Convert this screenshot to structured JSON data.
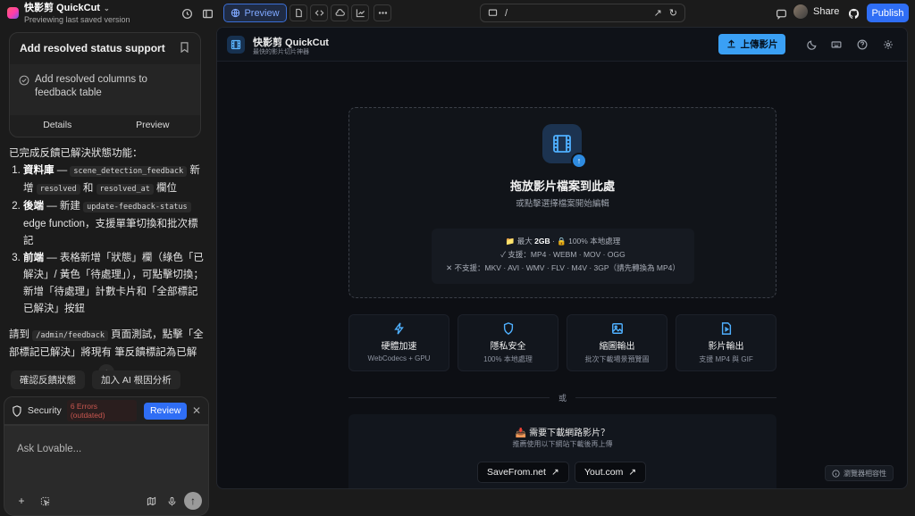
{
  "app": {
    "name": "快影剪 QuickCut",
    "subtitle": "Previewing last saved version"
  },
  "toolbar": {
    "preview_label": "Preview",
    "url_path": "/",
    "share_label": "Share",
    "publish_label": "Publish"
  },
  "card": {
    "title": "Add resolved status support",
    "item": "Add resolved columns to feedback table",
    "details_label": "Details",
    "preview_label": "Preview"
  },
  "message": {
    "intro": "已完成反饋已解決狀態功能：",
    "items": [
      {
        "head": "資料庫",
        "dash": " — ",
        "code1": "scene_detection_feedback",
        "t1": " 新增 ",
        "code2": "resolved",
        "t2": " 和 ",
        "code3": "resolved_at",
        "t3": " 欄位"
      },
      {
        "head": "後端",
        "dash": " — 新建 ",
        "code1": "update-feedback-status",
        "t1": " edge function，支援單筆切換和批次標記"
      },
      {
        "head": "前端",
        "text": " — 表格新增「狀態」欄（綠色「已解決」/ 黃色「待處理」），可點擊切換；新增「待處理」計數卡片和「全部標記已解決」按鈕"
      }
    ],
    "outro_pre": "請到 ",
    "outro_code": "/admin/feedback",
    "outro_post": " 頁面測試，點擊「全部標記已解決」將現有 筆反饋標記為已解"
  },
  "chips": [
    "確認反饋狀態",
    "加入 AI 根因分析"
  ],
  "security": {
    "label": "Security",
    "errors": "6 Errors (outdated)",
    "review_label": "Review"
  },
  "ask": {
    "placeholder": "Ask Lovable..."
  },
  "preview": {
    "title": "快影剪 QuickCut",
    "subtitle": "最快的影片切片神器",
    "upload_label": "上傳影片",
    "drop_title": "拖放影片檔案到此處",
    "drop_sub": "或點擊選擇檔案開始編輯",
    "info_line1_pre": "📁 最大 ",
    "info_line1_bold": "2GB",
    "info_line1_post": " · 🔒 100% 本地處理",
    "info_line2": "✓ 支援：MP4 · WEBM · MOV · OGG",
    "info_line3": "✕ 不支援：MKV · AVI · WMV · FLV · M4V · 3GP（請先轉換為 MP4）",
    "features": [
      {
        "title": "硬體加速",
        "sub": "WebCodecs + GPU",
        "icon": "bolt-icon"
      },
      {
        "title": "隱私安全",
        "sub": "100% 本地處理",
        "icon": "shield-icon"
      },
      {
        "title": "縮圖輸出",
        "sub": "批次下載場景預覽圖",
        "icon": "image-icon"
      },
      {
        "title": "影片輸出",
        "sub": "支援 MP4 與 GIF",
        "icon": "video-file-icon"
      }
    ],
    "or_label": "或",
    "download_q": "📥 需要下載網路影片？",
    "download_sub": "推薦使用以下網站下載後再上傳",
    "sites": [
      "SaveFrom.net",
      "Yout.com"
    ],
    "compat_label": "瀏覽器相容性"
  },
  "colors": {
    "accent": "#2f6ef5",
    "upload": "#3aa0f5",
    "error": "#c9564f"
  }
}
